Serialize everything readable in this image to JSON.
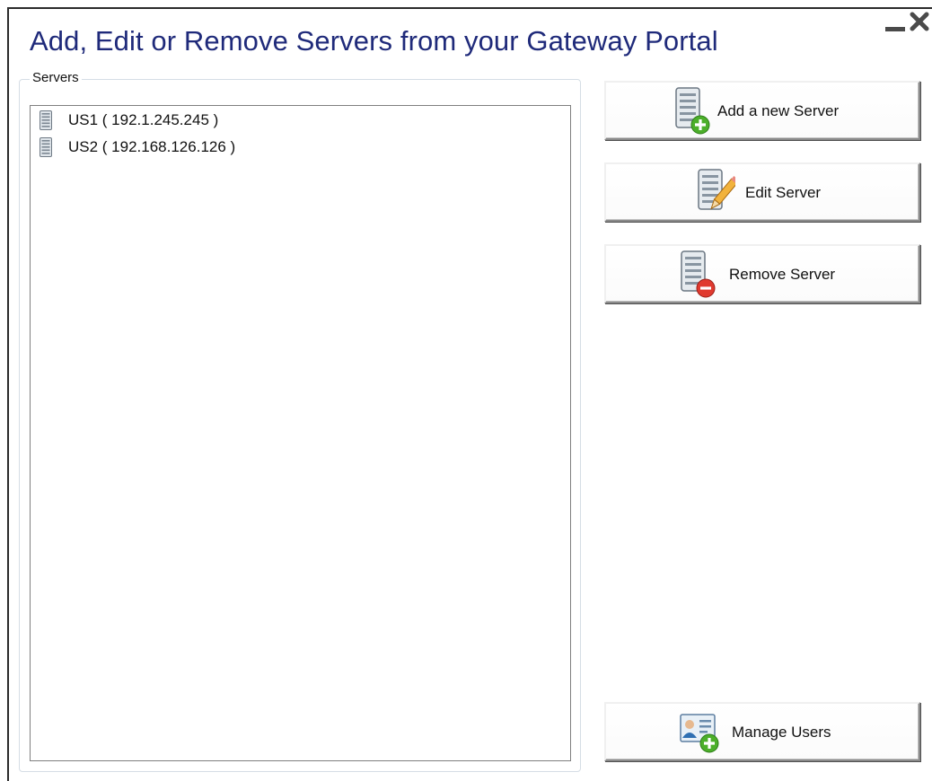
{
  "window": {
    "title": "Add, Edit or Remove Servers from your Gateway Portal"
  },
  "servers_group": {
    "label": "Servers",
    "items": [
      {
        "label": "US1 ( 192.1.245.245 )",
        "icon": "server-icon"
      },
      {
        "label": "US2 ( 192.168.126.126 )",
        "icon": "server-icon"
      }
    ]
  },
  "actions": {
    "add": {
      "label": "Add a new Server",
      "icon": "server-add-icon"
    },
    "edit": {
      "label": "Edit Server",
      "icon": "server-edit-icon"
    },
    "remove": {
      "label": "Remove Server",
      "icon": "server-remove-icon"
    },
    "manage_users": {
      "label": "Manage Users",
      "icon": "user-card-add-icon"
    }
  },
  "colors": {
    "title": "#1f2a7a",
    "add_badge": "#4caf2a",
    "remove_badge": "#e03a2f",
    "pencil": "#f2b33d"
  }
}
